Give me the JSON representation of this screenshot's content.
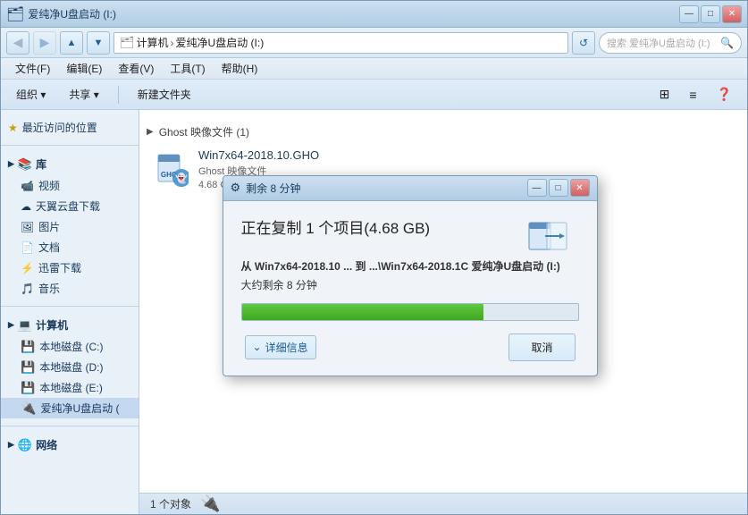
{
  "window": {
    "title": "爱纯净U盘启动 (I:)",
    "controls": {
      "minimize": "—",
      "maximize": "□",
      "close": "✕"
    }
  },
  "address_bar": {
    "back_arrow": "◀",
    "forward_arrow": "▶",
    "up_arrow": "▲",
    "path": "计算机 › 爱纯净U盘启动 (I:)",
    "path_parts": [
      "计算机",
      "爱纯净U盘启动 (I:)"
    ],
    "search_placeholder": "搜索 爱纯净U盘启动 (I:)"
  },
  "menu": {
    "items": [
      "文件(F)",
      "编辑(E)",
      "查看(V)",
      "工具(T)",
      "帮助(H)"
    ]
  },
  "toolbar": {
    "organize": "组织 ▾",
    "share": "共享 ▾",
    "new_folder": "新建文件夹"
  },
  "sidebar": {
    "recent_label": "最近访问的位置",
    "library_header": "库",
    "library_items": [
      "视频",
      "天翼云盘下载",
      "图片",
      "文档",
      "迅雷下载",
      "音乐"
    ],
    "computer_header": "计算机",
    "computer_items": [
      "本地磁盘 (C:)",
      "本地磁盘 (D:)",
      "本地磁盘 (E:)",
      "爱纯净U盘启动 ("
    ],
    "network_header": "网络"
  },
  "content": {
    "breadcrumb": "Ghost 映像文件 (1)",
    "file": {
      "name": "Win7x64-2018.10.GHO",
      "type": "Ghost 映像文件",
      "size": "4.68 GB"
    }
  },
  "status_bar": {
    "count": "1 个对象"
  },
  "dialog": {
    "title": "剩余 8 分钟",
    "title_icon": "⚙",
    "main_text": "正在复制 1 个项目(4.68 GB)",
    "from_label": "从",
    "from_path": "Win7x64-2018.10 ...",
    "to_label": "到",
    "to_path": "...\\Win7x64-2018.1C",
    "destination": "爱纯净U盘启动 (I:)",
    "remaining": "大约剩余 8 分钟",
    "progress_percent": 72,
    "details_label": "详细信息",
    "cancel_label": "取消",
    "controls": {
      "minimize": "—",
      "maximize": "□",
      "close": "✕"
    }
  }
}
